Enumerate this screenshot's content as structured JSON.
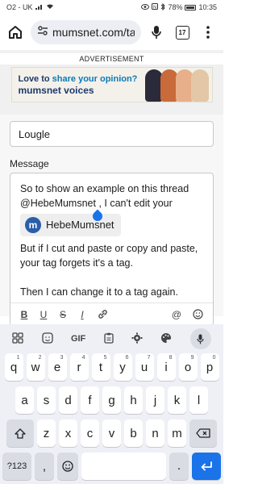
{
  "status_bar": {
    "carrier": "O2 - UK",
    "battery": "78%",
    "time": "10:35"
  },
  "browser": {
    "url": "mumsnet.com/ta",
    "tab_count": "17"
  },
  "ad": {
    "label": "ADVERTISEMENT",
    "line1_a": "Love to ",
    "line1_b": "share your opinion?",
    "line2": "mumsnet voices"
  },
  "form": {
    "title_value": "Lougle",
    "message_label": "Message",
    "message_p1": "So to show an example on this thread @HebeMumsnet , I can't edit your",
    "mention_initial": "m",
    "mention_name": "HebeMumsnet",
    "message_p2": "But if I cut and paste or copy and paste, your tag forgets it's a tag.",
    "message_p3": "Then I can change it to a tag again."
  },
  "toolbar": {
    "bold": "B",
    "underline": "U",
    "strike": "S",
    "italic": "I",
    "at": "@"
  },
  "keyboard": {
    "gif": "GIF",
    "row1": [
      {
        "k": "q",
        "s": "1"
      },
      {
        "k": "w",
        "s": "2"
      },
      {
        "k": "e",
        "s": "3"
      },
      {
        "k": "r",
        "s": "4"
      },
      {
        "k": "t",
        "s": "5"
      },
      {
        "k": "y",
        "s": "6"
      },
      {
        "k": "u",
        "s": "7"
      },
      {
        "k": "i",
        "s": "8"
      },
      {
        "k": "o",
        "s": "9"
      },
      {
        "k": "p",
        "s": "0"
      }
    ],
    "row2": [
      "a",
      "s",
      "d",
      "f",
      "g",
      "h",
      "j",
      "k",
      "l"
    ],
    "row3": [
      "z",
      "x",
      "c",
      "v",
      "b",
      "n",
      "m"
    ],
    "sym": "?123",
    "comma": ","
  }
}
